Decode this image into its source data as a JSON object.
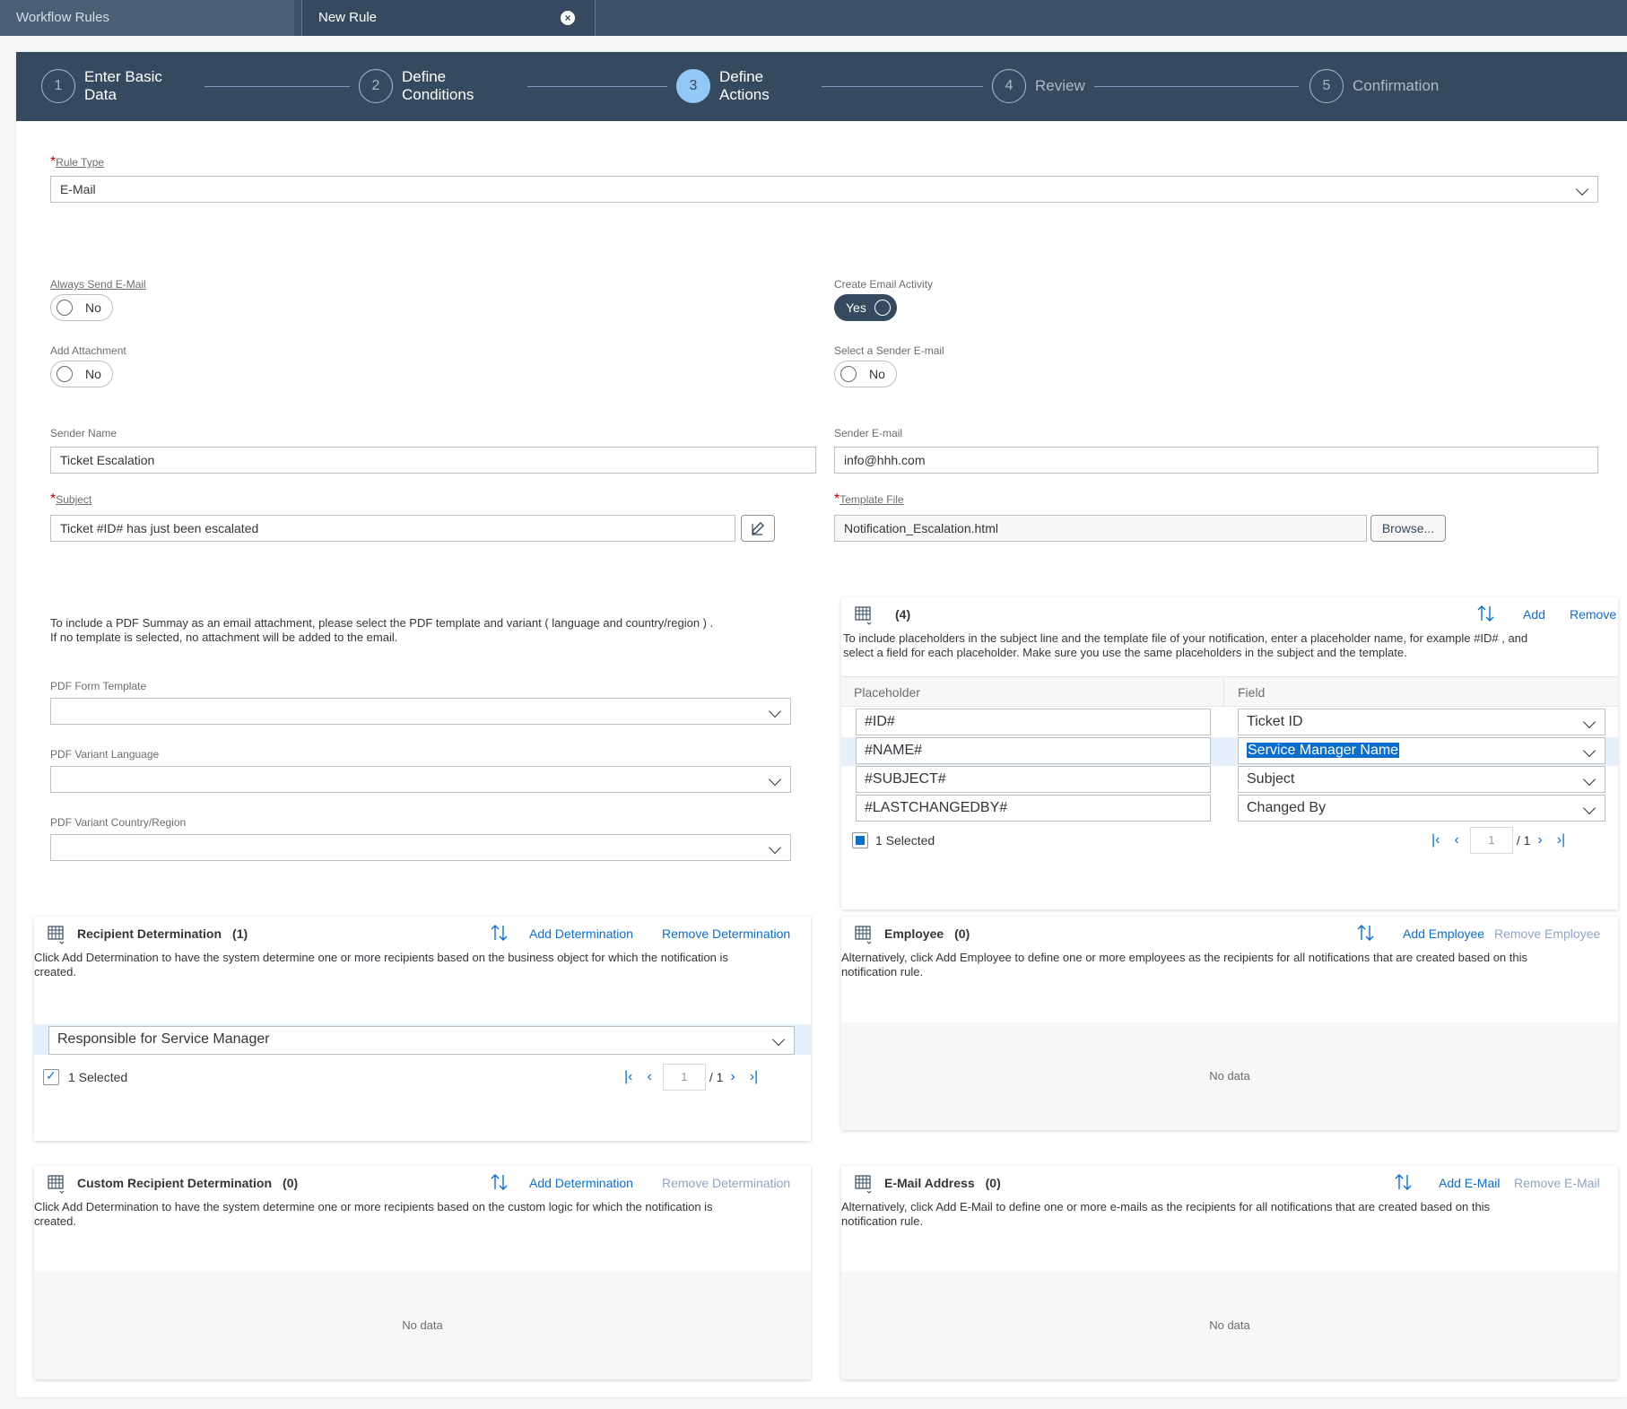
{
  "tabs": [
    {
      "label": "Workflow Rules"
    },
    {
      "label": "New Rule"
    }
  ],
  "wizard": {
    "steps": [
      {
        "num": "1",
        "label1": "Enter Basic",
        "label2": "Data"
      },
      {
        "num": "2",
        "label1": "Define",
        "label2": "Conditions"
      },
      {
        "num": "3",
        "label1": "Define",
        "label2": "Actions"
      },
      {
        "num": "4",
        "label1": "Review",
        "label2": ""
      },
      {
        "num": "5",
        "label1": "Confirmation",
        "label2": ""
      }
    ],
    "active_step": 3
  },
  "form": {
    "rule_type_label": "Rule Type",
    "rule_type_value": "E-Mail",
    "always_send_label": "Always Send E-Mail",
    "always_send_value": "No",
    "create_activity_label": "Create Email Activity",
    "create_activity_value": "Yes",
    "add_attachment_label": "Add Attachment",
    "add_attachment_value": "No",
    "select_sender_label": "Select a Sender E-mail",
    "select_sender_value": "No",
    "sender_name_label": "Sender Name",
    "sender_name_value": "Ticket Escalation",
    "sender_email_label": "Sender E-mail",
    "sender_email_value": "info@hhh.com",
    "subject_label": "Subject",
    "subject_value": "Ticket #ID# has just been escalated",
    "template_file_label": "Template File",
    "template_file_value": "Notification_Escalation.html",
    "browse_label": "Browse...",
    "pdf_note_line1": "To include a PDF Summay as an email attachment, please select the PDF template and variant ( language and country/region ) .",
    "pdf_note_line2": "If no template is selected, no attachment will be added to the email.",
    "pdf_form_template_label": "PDF Form Template",
    "pdf_variant_language_label": "PDF Variant Language",
    "pdf_variant_country_label": "PDF Variant Country/Region"
  },
  "placeholders": {
    "count": "(4)",
    "add_label": "Add",
    "remove_label": "Remove",
    "desc_line1": "To include placeholders in the subject line and the template file of your notification, enter a placeholder name, for example #ID# , and",
    "desc_line2": "select a field for each placeholder. Make sure you use the same placeholders in the subject and the template.",
    "col_placeholder": "Placeholder",
    "col_field": "Field",
    "rows": [
      {
        "placeholder": "#ID#",
        "field": "Ticket ID"
      },
      {
        "placeholder": "#NAME#",
        "field": "Service Manager Name"
      },
      {
        "placeholder": "#SUBJECT#",
        "field": "Subject"
      },
      {
        "placeholder": "#LASTCHANGEDBY#",
        "field": "Changed By"
      }
    ],
    "selected_label": "1 Selected",
    "page_input": "1",
    "page_total": "/ 1"
  },
  "recipient_determination": {
    "title": "Recipient Determination",
    "count": "(1)",
    "add_label": "Add Determination",
    "remove_label": "Remove Determination",
    "desc_line1": "Click Add Determination to have the system determine one or more recipients based on the business object for which the notification is",
    "desc_line2": "created.",
    "row_value": "Responsible for Service Manager",
    "selected_label": "1 Selected",
    "page_input": "1",
    "page_total": "/ 1"
  },
  "employee": {
    "title": "Employee",
    "count": "(0)",
    "add_label": "Add Employee",
    "remove_label": "Remove Employee",
    "desc_line1": "Alternatively, click Add Employee to define one or more employees as the recipients for all notifications that are created based on this",
    "desc_line2": "notification rule.",
    "nodata": "No data"
  },
  "custom_recipient": {
    "title": "Custom Recipient Determination",
    "count": "(0)",
    "add_label": "Add Determination",
    "remove_label": "Remove Determination",
    "desc_line1": "Click Add Determination to have the system determine one or more recipients based on the custom logic for which the notification is",
    "desc_line2": "created.",
    "nodata": "No data"
  },
  "email_address": {
    "title": "E-Mail Address",
    "count": "(0)",
    "add_label": "Add E-Mail",
    "remove_label": "Remove E-Mail",
    "desc_line1": "Alternatively, click Add E-Mail to define one or more e-mails as the recipients for all notifications that are created based on this",
    "desc_line2": "notification rule.",
    "nodata": "No data"
  },
  "colors": {
    "shell": "#354a5f",
    "accent": "#0a6ed1",
    "active_step": "#91c8f6",
    "required": "#bb0000"
  }
}
